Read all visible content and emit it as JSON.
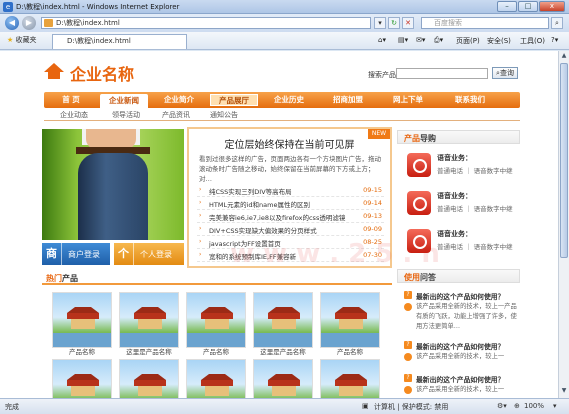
{
  "window": {
    "title": "D:\\教程\\index.html - Windows Internet Explorer",
    "min": "–",
    "max": "□",
    "close": "x"
  },
  "address": {
    "url": "D:\\教程\\index.html",
    "search_placeholder": "百度搜索"
  },
  "cmdbar": {
    "favorites": "收藏夹",
    "tab_title": "D:\\教程\\index.html",
    "page": "页面(P)",
    "safety": "安全(S)",
    "tools": "工具(O)"
  },
  "site": {
    "logo": "企业名称",
    "search_label": "搜索产品",
    "search_button": "查询",
    "nav": [
      "首 页",
      "企业新闻",
      "企业简介",
      "产品展厅",
      "企业历史",
      "招商加盟",
      "网上下单",
      "联系我们"
    ],
    "subnav": [
      "企业动态",
      "领导活动",
      "产品资讯",
      "通知公告"
    ],
    "btn_merchant": {
      "icon": "商",
      "label": "商户登录"
    },
    "btn_personal": {
      "icon": "个",
      "label": "个人登录"
    },
    "news": {
      "tag": "NEW",
      "headline": "定位层始终保持在当前可见屏",
      "desc": "看到过很多这样的广告，页面两边各有一个方块图片广告，拖动滚动条时广告随之移动，始终保留在当前屏幕的下方或上方；对…",
      "items": [
        {
          "title": "纯CSS实现三列DIV等高布局",
          "date": "09-15"
        },
        {
          "title": "HTML元素的id和name属性的区别",
          "date": "09-14"
        },
        {
          "title": "完美兼容ie6,ie7,ie8以及firefox的css透明滤镜",
          "date": "09-13"
        },
        {
          "title": "DIV+CSS实现缺大偏效果的分页样式",
          "date": "09-09"
        },
        {
          "title": "javascript为FF设置首页",
          "date": "08-25"
        },
        {
          "title": "宽和的系统预制库IE,FF兼容新",
          "date": "07-30"
        }
      ]
    },
    "hot": {
      "hl": "热门",
      "rest": "产品"
    },
    "products": [
      "产品名称",
      "这里是产品名称",
      "产品名称",
      "这里是产品名称",
      "产品名称"
    ],
    "guide": {
      "hl": "产品",
      "rest": "导购"
    },
    "contacts": [
      {
        "title": "语音业务：",
        "line": "普通电话 ｜ 语音数字中继"
      },
      {
        "title": "语音业务：",
        "line": "普通电话 ｜ 语音数字中继"
      },
      {
        "title": "语音业务：",
        "line": "普通电话 ｜ 语音数字中继"
      }
    ],
    "faq_head": {
      "hl": "使用",
      "rest": "问答"
    },
    "faq": [
      {
        "q": "最新出的这个产品如何使用？",
        "a": "该产品采用全新的技术，较上一产品有质的飞跃，功能上增强了许多，使用方法更简单…"
      },
      {
        "q": "最新出的这个产品如何使用？",
        "a": "该产品采用全新的技术，较上一"
      },
      {
        "q": "最新出的这个产品如何使用？",
        "a": "该产品采用全新的技术，较上一"
      }
    ]
  },
  "status": {
    "done": "完成",
    "zone": "计算机 | 保护模式: 禁用",
    "zoom": "100%"
  }
}
